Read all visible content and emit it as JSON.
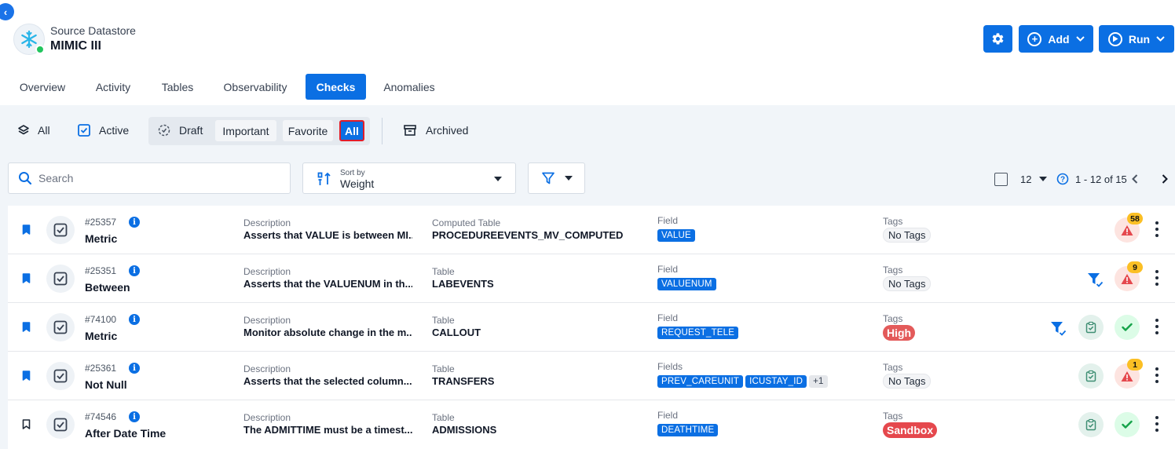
{
  "header": {
    "datastore_label": "Source Datastore",
    "datastore_name": "MIMIC III",
    "add_label": "Add",
    "run_label": "Run"
  },
  "tabs": [
    "Overview",
    "Activity",
    "Tables",
    "Observability",
    "Checks",
    "Anomalies"
  ],
  "active_tab": "Checks",
  "filters": {
    "all_label": "All",
    "active_label": "Active",
    "draft_label": "Draft",
    "important_label": "Important",
    "favorite_label": "Favorite",
    "sub_all_label": "All",
    "archived_label": "Archived"
  },
  "toolbar": {
    "search_placeholder": "Search",
    "sort_by_label": "Sort by",
    "sort_value": "Weight",
    "page_size": "12",
    "range_text": "1 - 12 of 15"
  },
  "rows": [
    {
      "id": "#25357",
      "name": "Metric",
      "desc_label": "Description",
      "desc": "Asserts that VALUE is between MI...",
      "table_label": "Computed Table",
      "table": "PROCEDUREEVENTS_MV_COMPUTED",
      "field_label": "Field",
      "fields": [
        "VALUE"
      ],
      "more": "",
      "tags_label": "Tags",
      "tag": "No Tags",
      "tag_color": "",
      "bookmarked": true,
      "funnel": false,
      "scheduled": false,
      "status": "anomaly",
      "count": "58"
    },
    {
      "id": "#25351",
      "name": "Between",
      "desc_label": "Description",
      "desc": "Asserts that the VALUENUM in th...",
      "table_label": "Table",
      "table": "LABEVENTS",
      "field_label": "Field",
      "fields": [
        "VALUENUM"
      ],
      "more": "",
      "tags_label": "Tags",
      "tag": "No Tags",
      "tag_color": "",
      "bookmarked": true,
      "funnel": true,
      "scheduled": false,
      "status": "anomaly",
      "count": "9"
    },
    {
      "id": "#74100",
      "name": "Metric",
      "desc_label": "Description",
      "desc": "Monitor absolute change in the m...",
      "table_label": "Table",
      "table": "CALLOUT",
      "field_label": "Field",
      "fields": [
        "REQUEST_TELE"
      ],
      "more": "",
      "tags_label": "Tags",
      "tag": "High",
      "tag_color": "#e35a5a",
      "bookmarked": true,
      "funnel": true,
      "scheduled": true,
      "status": "passed",
      "count": ""
    },
    {
      "id": "#25361",
      "name": "Not Null",
      "desc_label": "Description",
      "desc": "Asserts that the selected column...",
      "table_label": "Table",
      "table": "TRANSFERS",
      "field_label": "Fields",
      "fields": [
        "PREV_CAREUNIT",
        "ICUSTAY_ID"
      ],
      "more": "+1",
      "tags_label": "Tags",
      "tag": "No Tags",
      "tag_color": "",
      "bookmarked": true,
      "funnel": false,
      "scheduled": true,
      "status": "anomaly",
      "count": "1"
    },
    {
      "id": "#74546",
      "name": "After Date Time",
      "desc_label": "Description",
      "desc": "The ADMITTIME must be a timest...",
      "table_label": "Table",
      "table": "ADMISSIONS",
      "field_label": "Field",
      "fields": [
        "DEATHTIME"
      ],
      "more": "",
      "tags_label": "Tags",
      "tag": "Sandbox",
      "tag_color": "#e5484d",
      "bookmarked": false,
      "funnel": false,
      "scheduled": true,
      "status": "passed",
      "count": ""
    }
  ],
  "colors": {
    "primary": "#0b6fe3",
    "anomaly_badge": "#fbbf24",
    "anomaly_icon": "#e5484d",
    "passed": "#16a34a"
  }
}
